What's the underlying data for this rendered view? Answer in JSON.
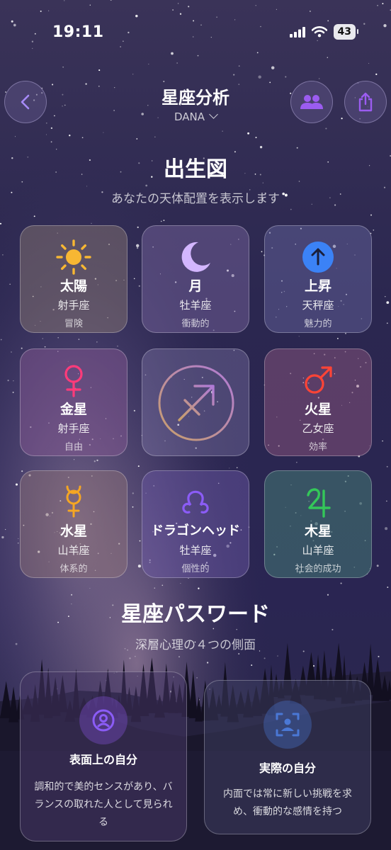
{
  "status_bar": {
    "time": "19:11",
    "battery": "43"
  },
  "header": {
    "title": "星座分析",
    "profile_name": "DANA"
  },
  "birth_chart": {
    "title": "出生図",
    "subtitle": "あなたの天体配置を表示します",
    "cards": [
      {
        "name": "太陽",
        "sign": "射手座",
        "trait": "冒険",
        "icon": "sun-icon",
        "color": "#f7b733"
      },
      {
        "name": "月",
        "sign": "牡羊座",
        "trait": "衝動的",
        "icon": "moon-icon",
        "color": "#d3b6ff"
      },
      {
        "name": "上昇",
        "sign": "天秤座",
        "trait": "魅力的",
        "icon": "arrow-up-icon",
        "color": "#3b82f6"
      },
      {
        "name": "金星",
        "sign": "射手座",
        "trait": "自由",
        "icon": "venus-icon",
        "color": "#ff3b7a"
      },
      {
        "name": "",
        "sign": "",
        "trait": "",
        "icon": "sagittarius-icon",
        "color": "#c9a06a"
      },
      {
        "name": "火星",
        "sign": "乙女座",
        "trait": "効率",
        "icon": "mars-icon",
        "color": "#ff4436"
      },
      {
        "name": "水星",
        "sign": "山羊座",
        "trait": "体系的",
        "icon": "mercury-icon",
        "color": "#f5a623"
      },
      {
        "name": "ドラゴンヘッド",
        "sign": "牡羊座",
        "trait": "個性的",
        "icon": "dragon-head-icon",
        "color": "#8b5cf6"
      },
      {
        "name": "木星",
        "sign": "山羊座",
        "trait": "社会的成功",
        "icon": "jupiter-icon",
        "color": "#34c759"
      }
    ]
  },
  "password_section": {
    "title": "星座パスワード",
    "subtitle": "深層心理の４つの側面",
    "cards": [
      {
        "title": "表面上の自分",
        "description": "調和的で美的センスがあり、バランスの取れた人として見られる",
        "icon": "person-circle-icon",
        "color": "#7c4dcc"
      },
      {
        "title": "実際の自分",
        "description": "内面では常に新しい挑戦を求め、衝動的な感情を持つ",
        "icon": "person-scan-icon",
        "color": "#4a78d6"
      }
    ]
  }
}
